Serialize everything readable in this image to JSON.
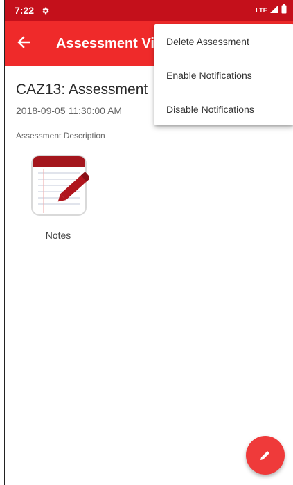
{
  "status_bar": {
    "time": "7:22",
    "network": "LTE",
    "icons": [
      "gear-icon",
      "signal-icon",
      "battery-icon"
    ]
  },
  "app_bar": {
    "title": "Assessment View",
    "back_icon": "arrow-left-icon"
  },
  "assessment": {
    "title": "CAZ13: Assessment",
    "datetime": "2018-09-05 11:30:00 AM",
    "description_label": "Assessment Description"
  },
  "notes": {
    "label": "Notes",
    "icon": "notepad-pencil-icon"
  },
  "menu": {
    "items": [
      {
        "label": "Delete Assessment"
      },
      {
        "label": "Enable Notifications"
      },
      {
        "label": "Disable Notifications"
      }
    ]
  },
  "fab": {
    "icon": "pencil-icon"
  },
  "colors": {
    "status_bar": "#c4101b",
    "app_bar": "#ef2a2a",
    "fab": "#ef3a3a"
  }
}
